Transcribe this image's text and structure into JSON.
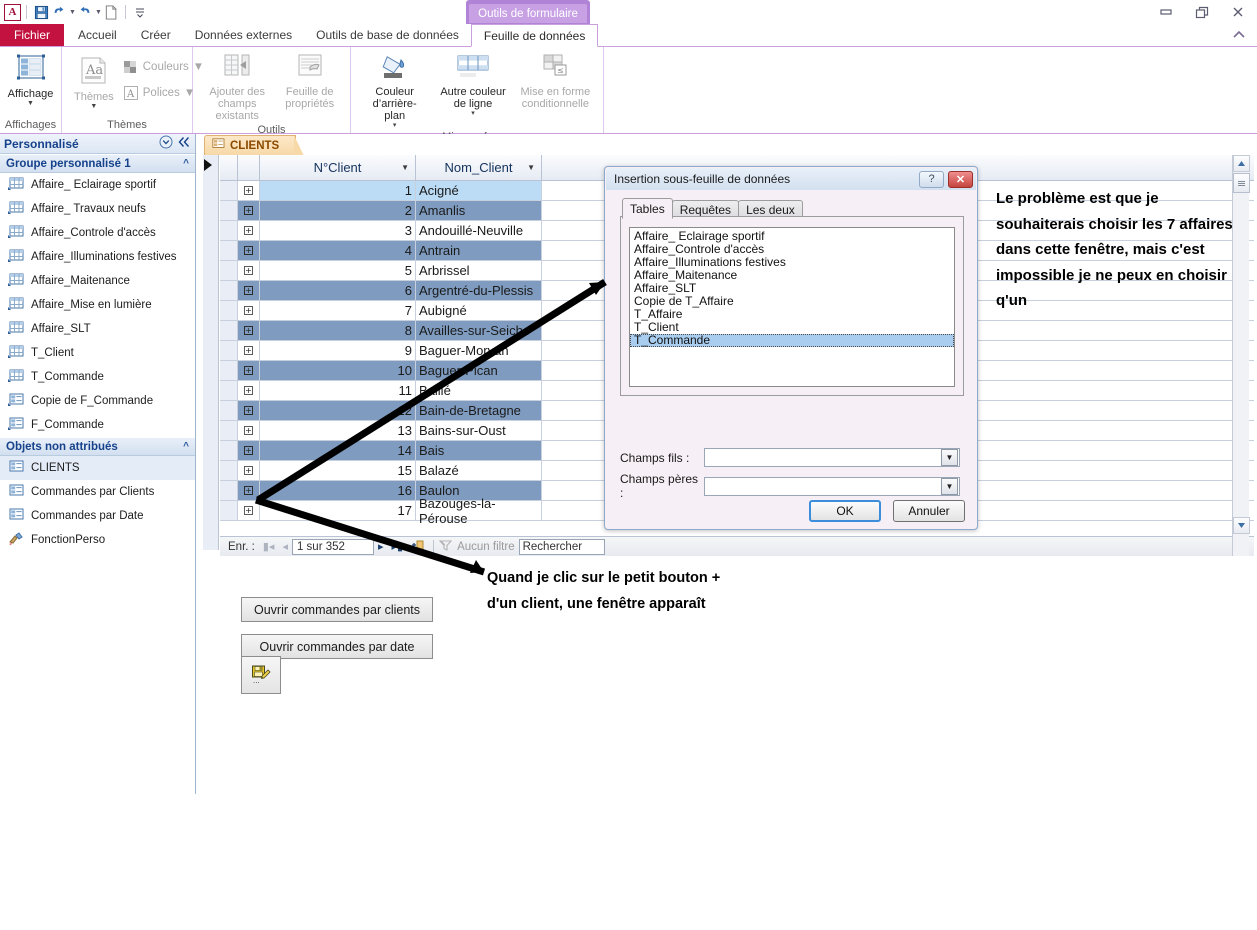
{
  "app": {
    "icon_label": "A",
    "quick_access": [
      {
        "name": "save-icon",
        "label": "Enregistrer"
      },
      {
        "name": "undo-icon",
        "label": "Annuler"
      },
      {
        "name": "redo-icon",
        "label": "Rétablir"
      },
      {
        "name": "new-icon",
        "label": "Nouveau"
      },
      {
        "name": "customize-qat-icon",
        "label": "Personnaliser"
      }
    ],
    "window_controls": [
      {
        "name": "minimize-button",
        "glyph": "–"
      },
      {
        "name": "restore-button",
        "glyph": "❐"
      },
      {
        "name": "close-button",
        "glyph": "✕"
      }
    ]
  },
  "ribbon": {
    "contextual_tab_header": "Outils de formulaire",
    "file_tab": "Fichier",
    "tabs": [
      {
        "label": "Accueil",
        "selected": false
      },
      {
        "label": "Créer",
        "selected": false
      },
      {
        "label": "Données externes",
        "selected": false
      },
      {
        "label": "Outils de base de données",
        "selected": false
      },
      {
        "label": "Feuille de données",
        "selected": true
      }
    ],
    "groups": [
      {
        "name": "affichages",
        "label": "Affichages",
        "buttons": [
          {
            "name": "affichage-button",
            "label": "Affichage",
            "icon": "datasheet-view-icon",
            "has_caret": true,
            "disabled": false
          }
        ]
      },
      {
        "name": "themes",
        "label": "Thèmes",
        "buttons": [
          {
            "name": "themes-button",
            "label": "Thèmes",
            "icon": "theme-icon",
            "has_caret": true,
            "disabled": true
          },
          {
            "name": "couleurs-button",
            "label": "Couleurs",
            "icon": "colors-icon",
            "has_caret": true,
            "disabled": true
          },
          {
            "name": "polices-button",
            "label": "Polices",
            "icon": "fonts-icon",
            "has_caret": true,
            "disabled": true
          }
        ]
      },
      {
        "name": "outils",
        "label": "Outils",
        "buttons": [
          {
            "name": "ajouter-champs-button",
            "label": "Ajouter des\nchamps existants",
            "icon": "add-existing-fields-icon",
            "disabled": true
          },
          {
            "name": "feuille-proprietes-button",
            "label": "Feuille de\npropriétés",
            "icon": "property-sheet-icon",
            "disabled": true
          }
        ]
      },
      {
        "name": "mise-en-forme",
        "label": "Mise en forme",
        "buttons": [
          {
            "name": "couleur-arriere-plan-button",
            "label": "Couleur\nd’arrière-plan",
            "icon": "paint-bucket-icon",
            "has_caret": true,
            "disabled": false
          },
          {
            "name": "autre-couleur-ligne-button",
            "label": "Autre couleur\nde ligne",
            "icon": "alternate-row-color-icon",
            "has_caret": true,
            "disabled": false
          },
          {
            "name": "mise-en-forme-conditionnelle-button",
            "label": "Mise en forme\nconditionnelle",
            "icon": "conditional-formatting-icon",
            "disabled": true
          }
        ]
      }
    ]
  },
  "navpane": {
    "title": "Personnalisé",
    "groups": [
      {
        "name": "groupe-personnalise-1",
        "label": "Groupe personnalisé 1",
        "items": [
          {
            "label": "Affaire_ Eclairage sportif",
            "icon": "table-shortcut-icon",
            "selected": false
          },
          {
            "label": "Affaire_ Travaux neufs",
            "icon": "table-shortcut-icon",
            "selected": false
          },
          {
            "label": "Affaire_Controle d'accès",
            "icon": "table-shortcut-icon",
            "selected": false
          },
          {
            "label": "Affaire_Illuminations festives",
            "icon": "table-shortcut-icon",
            "selected": false
          },
          {
            "label": "Affaire_Maitenance",
            "icon": "table-shortcut-icon",
            "selected": false
          },
          {
            "label": "Affaire_Mise en lumière",
            "icon": "table-shortcut-icon",
            "selected": false
          },
          {
            "label": "Affaire_SLT",
            "icon": "table-shortcut-icon",
            "selected": false
          },
          {
            "label": "T_Client",
            "icon": "table-shortcut-icon",
            "selected": false
          },
          {
            "label": "T_Commande",
            "icon": "table-shortcut-icon",
            "selected": false
          },
          {
            "label": "Copie de F_Commande",
            "icon": "form-shortcut-icon",
            "selected": false
          },
          {
            "label": "F_Commande",
            "icon": "form-shortcut-icon",
            "selected": false
          }
        ]
      },
      {
        "name": "objets-non-attribues",
        "label": "Objets non attribués",
        "items": [
          {
            "label": "CLIENTS",
            "icon": "form-icon",
            "selected": true
          },
          {
            "label": "Commandes par Clients",
            "icon": "form-icon",
            "selected": false
          },
          {
            "label": "Commandes par Date",
            "icon": "form-icon",
            "selected": false
          },
          {
            "label": "FonctionPerso",
            "icon": "module-icon",
            "selected": false
          }
        ]
      }
    ]
  },
  "document": {
    "tab_label": "CLIENTS",
    "datasheet": {
      "columns": [
        "N°Client",
        "Nom_Client"
      ],
      "rows": [
        {
          "id": "1",
          "name": "Acigné"
        },
        {
          "id": "2",
          "name": "Amanlis"
        },
        {
          "id": "3",
          "name": "Andouillé-Neuville"
        },
        {
          "id": "4",
          "name": "Antrain"
        },
        {
          "id": "5",
          "name": "Arbrissel"
        },
        {
          "id": "6",
          "name": "Argentré-du-Plessis"
        },
        {
          "id": "7",
          "name": "Aubigné"
        },
        {
          "id": "8",
          "name": "Availles-sur-Seiche"
        },
        {
          "id": "9",
          "name": "Baguer-Morvan"
        },
        {
          "id": "10",
          "name": "Baguer-Pican"
        },
        {
          "id": "11",
          "name": "Baillé"
        },
        {
          "id": "12",
          "name": "Bain-de-Bretagne"
        },
        {
          "id": "13",
          "name": "Bains-sur-Oust"
        },
        {
          "id": "14",
          "name": "Bais"
        },
        {
          "id": "15",
          "name": "Balazé"
        },
        {
          "id": "16",
          "name": "Baulon"
        },
        {
          "id": "17",
          "name": "Bazouges-la-Pérouse"
        }
      ]
    },
    "record_nav": {
      "label": "Enr. :",
      "position": "1 sur 352",
      "filter_label": "Aucun filtre",
      "search_placeholder": "Rechercher"
    },
    "form_buttons": [
      {
        "name": "ouvrir-commandes-par-clients-button",
        "label": "Ouvrir commandes par clients"
      },
      {
        "name": "ouvrir-commandes-par-date-button",
        "label": "Ouvrir commandes par date"
      }
    ],
    "save_button_icon": "save-record-icon"
  },
  "dialog": {
    "title": "Insertion sous-feuille de données",
    "titlebar_buttons": [
      {
        "name": "help-button",
        "glyph": "?"
      },
      {
        "name": "close-button",
        "glyph": "✕"
      }
    ],
    "tabs": [
      {
        "label": "Tables",
        "selected": true
      },
      {
        "label": "Requêtes",
        "selected": false
      },
      {
        "label": "Les deux",
        "selected": false
      }
    ],
    "list_items": [
      {
        "label": "Affaire_ Eclairage sportif",
        "selected": false
      },
      {
        "label": "Affaire_Controle d'accès",
        "selected": false
      },
      {
        "label": "Affaire_Illuminations festives",
        "selected": false
      },
      {
        "label": "Affaire_Maitenance",
        "selected": false
      },
      {
        "label": "Affaire_SLT",
        "selected": false
      },
      {
        "label": "Copie de T_Affaire",
        "selected": false
      },
      {
        "label": "T_Affaire",
        "selected": false
      },
      {
        "label": "T_Client",
        "selected": false
      },
      {
        "label": "T_Commande",
        "selected": true
      }
    ],
    "fields": [
      {
        "name": "champs-fils",
        "label": "Champs fils :",
        "value": ""
      },
      {
        "name": "champs-peres",
        "label": "Champs pères :",
        "value": ""
      }
    ],
    "ok_label": "OK",
    "cancel_label": "Annuler"
  },
  "annotations": {
    "right": "Le problème est que je souhaiterais choisir les 7 affaires dans cette fenêtre, mais c'est impossible je ne peux en choisir q'un",
    "bottom": "Quand je clic sur le petit bouton + d'un client, une fenêtre apparaît"
  },
  "colors": {
    "file_tab": "#c3123f",
    "contextual": "#b183d6",
    "nav_header_text": "#15428b",
    "doc_tab": "#f7d9a8",
    "row_alt": "#7f9cc0",
    "row_current": "#bcdcf5",
    "list_selected": "#a8cdef"
  }
}
